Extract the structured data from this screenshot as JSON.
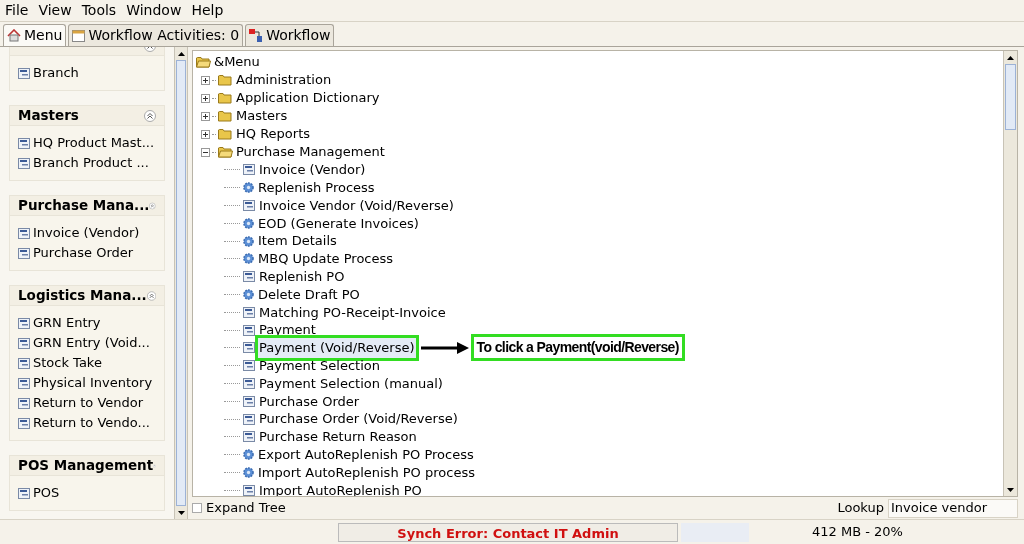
{
  "menu_bar": [
    "File",
    "View",
    "Tools",
    "Window",
    "Help"
  ],
  "tabs": [
    {
      "label": "Menu",
      "selected": true
    },
    {
      "label": "Workflow Activities: 0",
      "selected": false
    },
    {
      "label": "Workflow",
      "selected": false
    }
  ],
  "sidebar": {
    "groups": [
      {
        "items": [
          "Branch"
        ]
      },
      {
        "title": "Masters",
        "items": [
          "HQ Product Mast...",
          "Branch Product ..."
        ]
      },
      {
        "title": "Purchase Mana...",
        "items": [
          "Invoice (Vendor)",
          "Purchase Order"
        ]
      },
      {
        "title": "Logistics Mana...",
        "items": [
          "GRN Entry",
          "GRN Entry (Void...",
          "Stock Take",
          "Physical Inventory",
          "Return to Vendor",
          "Return to Vendo..."
        ]
      },
      {
        "title": "POS Management",
        "items": [
          "POS"
        ]
      }
    ]
  },
  "tree": {
    "label": "&Menu",
    "expanded": true,
    "children": [
      {
        "label": "Administration",
        "kind": "folder",
        "expanded": false
      },
      {
        "label": "Application Dictionary",
        "kind": "folder",
        "expanded": false
      },
      {
        "label": "Masters",
        "kind": "folder",
        "expanded": false
      },
      {
        "label": "HQ Reports",
        "kind": "folder",
        "expanded": false
      },
      {
        "label": "Purchase Management",
        "kind": "folder",
        "expanded": true,
        "children": [
          {
            "label": "Invoice (Vendor)",
            "kind": "window",
            "selected": false
          },
          {
            "label": "Replenish Process",
            "kind": "process",
            "selected": false
          },
          {
            "label": "Invoice Vendor (Void/Reverse)",
            "kind": "window",
            "selected": false
          },
          {
            "label": "EOD (Generate Invoices)",
            "kind": "process",
            "selected": false
          },
          {
            "label": "Item Details",
            "kind": "process",
            "selected": false
          },
          {
            "label": "MBQ Update Process",
            "kind": "process",
            "selected": false
          },
          {
            "label": "Replenish PO",
            "kind": "window",
            "selected": false
          },
          {
            "label": "Delete Draft PO",
            "kind": "process",
            "selected": false
          },
          {
            "label": "Matching PO-Receipt-Invoice",
            "kind": "window",
            "selected": false
          },
          {
            "label": "Payment",
            "kind": "window",
            "selected": false
          },
          {
            "label": "Payment (Void/Reverse)",
            "kind": "window",
            "selected": true,
            "annotation": "To click a Payment(void/Reverse)"
          },
          {
            "label": "Payment Selection",
            "kind": "window",
            "selected": false
          },
          {
            "label": "Payment Selection (manual)",
            "kind": "window",
            "selected": false
          },
          {
            "label": "Purchase Order",
            "kind": "window",
            "selected": false
          },
          {
            "label": "Purchase Order (Void/Reverse)",
            "kind": "window",
            "selected": false
          },
          {
            "label": "Purchase Return Reason",
            "kind": "window",
            "selected": false
          },
          {
            "label": "Export AutoReplenish PO Process",
            "kind": "process",
            "selected": false
          },
          {
            "label": "Import AutoReplenish PO process",
            "kind": "process",
            "selected": false
          },
          {
            "label": "Import AutoReplenish PO",
            "kind": "window",
            "selected": false
          }
        ]
      }
    ]
  },
  "expand_tree": {
    "label": "Expand Tree",
    "checked": false
  },
  "lookup": {
    "label": "Lookup",
    "value": "Invoice vendor"
  },
  "status_bar": {
    "error_button": "Synch Error: Contact IT Admin",
    "memory": "412 MB - 20%"
  }
}
